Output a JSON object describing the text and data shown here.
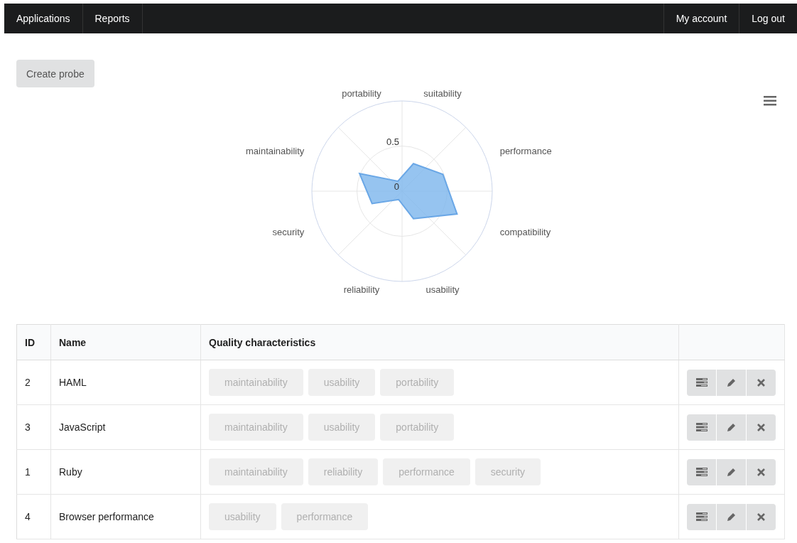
{
  "nav": {
    "left": [
      "Applications",
      "Reports"
    ],
    "right": [
      "My account",
      "Log out"
    ]
  },
  "create_button": "Create probe",
  "radar": {
    "axis_labels": [
      "suitability",
      "performance",
      "compatibility",
      "usability",
      "reliability",
      "security",
      "maintainability",
      "portability"
    ],
    "ring_labels": [
      "0.5",
      "0"
    ]
  },
  "table": {
    "columns": [
      "ID",
      "Name",
      "Quality characteristics"
    ],
    "rows": [
      {
        "id": "2",
        "name": "HAML",
        "tags": [
          "maintainability",
          "usability",
          "portability"
        ]
      },
      {
        "id": "3",
        "name": "JavaScript",
        "tags": [
          "maintainability",
          "usability",
          "portability"
        ]
      },
      {
        "id": "1",
        "name": "Ruby",
        "tags": [
          "maintainability",
          "reliability",
          "performance",
          "security"
        ]
      },
      {
        "id": "4",
        "name": "Browser performance",
        "tags": [
          "usability",
          "performance"
        ]
      }
    ]
  }
}
